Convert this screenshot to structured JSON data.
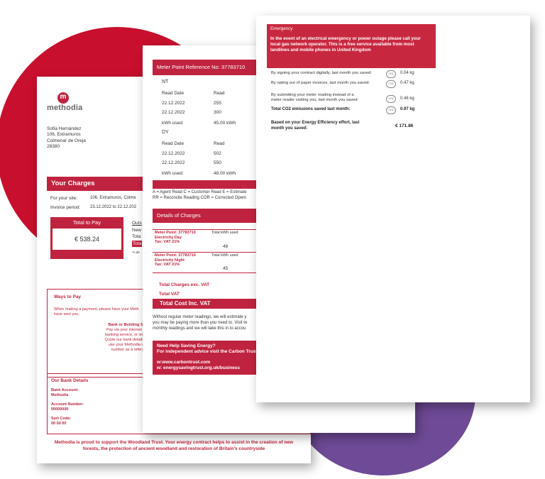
{
  "colors": {
    "brand_red": "#c0233f",
    "purple": "#6f4a96"
  },
  "page1": {
    "logo": {
      "mark": "m",
      "name": "methodia"
    },
    "address": [
      "Sofia Hernández",
      "106, Extramuros",
      "Colmenar de Oreja",
      "28380"
    ],
    "your_charges": {
      "title": "Your Charges",
      "site_label": "For your site:",
      "site_value": "106, Extramuros, Colme",
      "period_label": "Invoice period:",
      "period_value": "23.12.2022 to 22.12.202",
      "total_to_pay_label": "Total to Pay",
      "total_to_pay_value": "€ 538.24",
      "outstanding": [
        "Outs",
        "New",
        "Tota",
        "Tota"
      ],
      "footnote": "*A de"
    },
    "ways_to_pay": {
      "title": "Ways to Pay",
      "intro": [
        "When making a payment, please have your Meth",
        "have sent you."
      ],
      "bank_title": "Bank or Building Society",
      "bank_text": [
        "Pay via your internet or phon",
        "banking service, or visit a bran",
        "Quote our bank details (below)",
        "use your Methodia accoun",
        "number as a reference."
      ]
    },
    "bank_details": {
      "title": "Our Bank Details",
      "fields": [
        {
          "label": "Bank Account:",
          "value": "Methodia"
        },
        {
          "label": "Account Number:",
          "value": "00000000"
        },
        {
          "label": "Sort Code:",
          "value": "00 00 00"
        }
      ]
    },
    "footer": [
      "Methodia is proud to support the Woodland Trust. Your energy contract helps to assist in the creation of new",
      "forests, the protection of ancient woodland and restoration of Britain's countryside"
    ]
  },
  "page2": {
    "meter_point_title": "Meter Point Reference No: 37783710",
    "registers": [
      {
        "name": "NT",
        "col_date": "Read Date",
        "col_read": "Read",
        "reads": [
          {
            "date": "22.12.2022",
            "read": "255"
          },
          {
            "date": "22.12.2022",
            "read": "300"
          }
        ],
        "kwh_label": "kWh used:",
        "kwh_value": "45.00 kWh"
      },
      {
        "name": "DY",
        "col_date": "Read Date",
        "col_read": "Read",
        "reads": [
          {
            "date": "22.12.2022",
            "read": "502"
          },
          {
            "date": "22.12.2022",
            "read": "550"
          }
        ],
        "kwh_label": "kWh used:",
        "kwh_value": "48.00 kWh"
      }
    ],
    "legend": [
      "A = Agent Read C = Customer Read E = Estimate",
      "RR = Reconcile Reading COR = Corrected Openi"
    ],
    "details_title": "Details of Charges",
    "charges": [
      {
        "meter": "Meter Point: 37783710",
        "desc": "Electricity Day",
        "tax": "Tax:  VAT 21%",
        "col": "Total kWh used",
        "kwh": "48"
      },
      {
        "meter": "Meter Point: 37783710",
        "desc": "Electricity Night",
        "tax": "Tax:  VAT 21%",
        "col": "Total kWh used",
        "kwh": "45"
      }
    ],
    "total_exc_vat": "Total Charges exc. VAT",
    "total_vat": "Total VAT",
    "total_inc_vat": "Total Cost Inc. VAT",
    "note": [
      "Without regular meter readings, we will estimate y",
      "you may be paying more than you need to. Visit te",
      "monthly readings and we will take this in to accou"
    ],
    "help": {
      "title": "Need Help Saving Energy?",
      "subtitle": "For independent advice visit the Carbon Trust",
      "link1": "w:www.carbontrust.com",
      "link2": "w: energysavingtrust.org.uk/business"
    }
  },
  "page3": {
    "emergency": {
      "title": "Emergency",
      "text": [
        "In the event of an electrical emergency or power outage please call your",
        "local gas network operator. This is a free service available from most",
        "landlines and mobile phones in United Kingdom"
      ]
    },
    "savings": [
      {
        "text": [
          "By signing your contract digitally, last month you saved:"
        ],
        "icon": "co2-cloud-icon",
        "value": "0.04 kg",
        "bold": false
      },
      {
        "text": [
          "By opting out of paper invoices, last month you saved:"
        ],
        "icon": "co2-cloud-icon",
        "value": "0.47 kg",
        "bold": false
      },
      {
        "text": [
          "By submitting your meter reading instead of a",
          "meter reader visiting you, last month you saved:"
        ],
        "icon": "co2-cloud-icon",
        "value": "0.46 kg",
        "bold": false
      },
      {
        "text": [
          "Total CO2 emissions saved last month:"
        ],
        "icon": "co2-cloud-icon",
        "value": "0.97 kg",
        "bold": true
      }
    ],
    "efficiency": {
      "text": [
        "Based on your Energy Efficiency effort, last",
        "month you saved:"
      ],
      "value": "€ 171.86"
    },
    "cloud_label": "CO2"
  }
}
